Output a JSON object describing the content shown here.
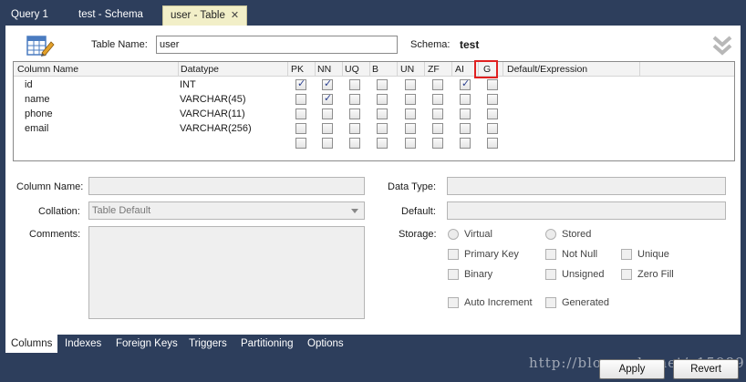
{
  "tabs": [
    {
      "label": "Query 1"
    },
    {
      "label": "test - Schema"
    },
    {
      "label": "user - Table",
      "close": "✕"
    }
  ],
  "header": {
    "table_name_label": "Table Name:",
    "table_name_value": "user",
    "schema_label": "Schema:",
    "schema_value": "test"
  },
  "columns_header": [
    "Column Name",
    "Datatype",
    "PK",
    "NN",
    "UQ",
    "B",
    "UN",
    "ZF",
    "AI",
    "G",
    "Default/Expression"
  ],
  "rows": [
    {
      "name": "id",
      "type": "INT",
      "flags": [
        true,
        true,
        false,
        false,
        false,
        false,
        true,
        false
      ]
    },
    {
      "name": "name",
      "type": "VARCHAR(45)",
      "flags": [
        false,
        true,
        false,
        false,
        false,
        false,
        false,
        false
      ]
    },
    {
      "name": "phone",
      "type": "VARCHAR(11)",
      "flags": [
        false,
        false,
        false,
        false,
        false,
        false,
        false,
        false
      ]
    },
    {
      "name": "email",
      "type": "VARCHAR(256)",
      "flags": [
        false,
        false,
        false,
        false,
        false,
        false,
        false,
        false
      ]
    },
    {
      "name": "",
      "type": "",
      "flags": [
        false,
        false,
        false,
        false,
        false,
        false,
        false,
        false
      ]
    }
  ],
  "details": {
    "column_name_label": "Column Name:",
    "collation_label": "Collation:",
    "collation_value": "Table Default",
    "comments_label": "Comments:",
    "data_type_label": "Data Type:",
    "default_label": "Default:",
    "storage_label": "Storage:",
    "virtual": "Virtual",
    "stored": "Stored",
    "primary_key": "Primary Key",
    "not_null": "Not Null",
    "unique": "Unique",
    "binary": "Binary",
    "unsigned": "Unsigned",
    "zero_fill": "Zero Fill",
    "auto_increment": "Auto Increment",
    "generated": "Generated"
  },
  "bottom_tabs": [
    "Columns",
    "Indexes",
    "Foreign Keys",
    "Triggers",
    "Partitioning",
    "Options"
  ],
  "buttons": {
    "apply": "Apply",
    "revert": "Revert"
  },
  "watermark": "http://blog.csdn.net/z15989"
}
